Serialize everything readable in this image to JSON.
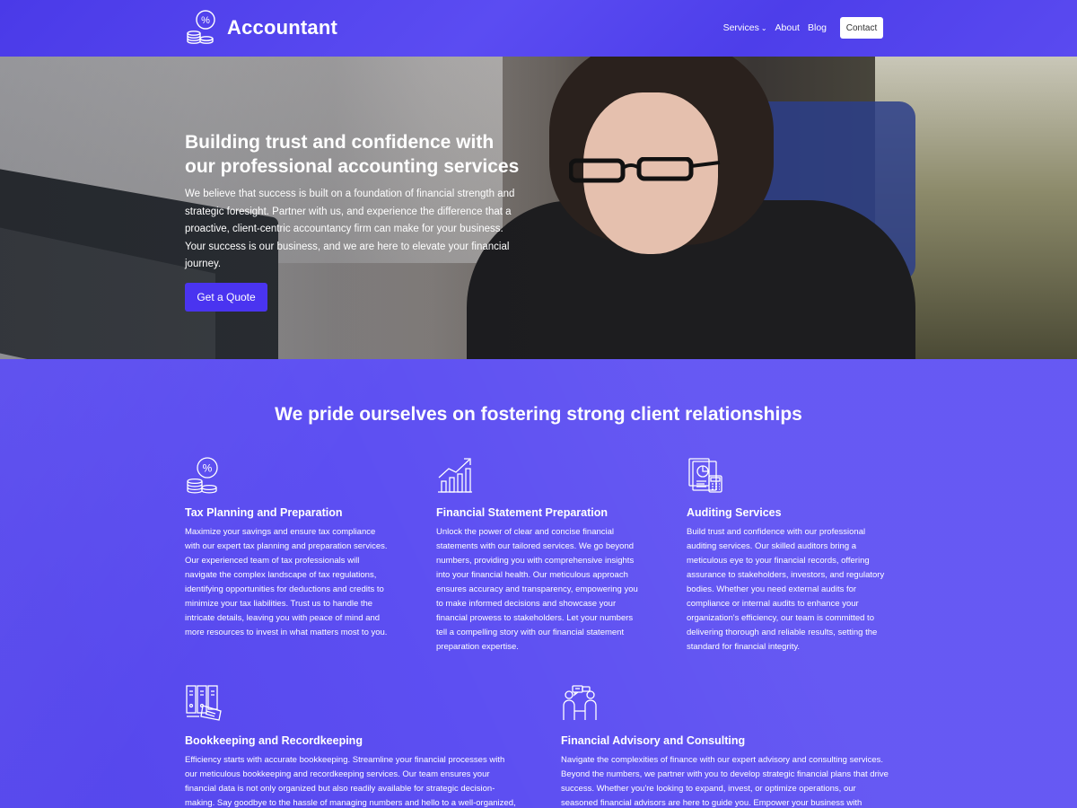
{
  "header": {
    "brand": "Accountant",
    "nav": {
      "services": "Services",
      "about": "About",
      "blog": "Blog",
      "contact": "Contact"
    }
  },
  "hero": {
    "title": "Building trust and confidence with our professional accounting services",
    "text": "We believe that success is built on a foundation of financial strength and strategic foresight. Partner with us, and experience the difference that a proactive, client-centric accountancy firm can make for your business. Your success is our business, and we are here to elevate your financial journey.",
    "cta": "Get a Quote"
  },
  "main": {
    "title": "We pride ourselves on fostering strong client relationships",
    "services": [
      {
        "icon": "coins-percent-icon",
        "title": "Tax Planning and Preparation",
        "desc": "Maximize your savings and ensure tax compliance with our expert tax planning and preparation services. Our experienced team of tax professionals will navigate the complex landscape of tax regulations, identifying opportunities for deductions and credits to minimize your tax liabilities. Trust us to handle the intricate details, leaving you with peace of mind and more resources to invest in what matters most to you."
      },
      {
        "icon": "growth-chart-icon",
        "title": "Financial Statement Preparation",
        "desc": "Unlock the power of clear and concise financial statements with our tailored services. We go beyond numbers, providing you with comprehensive insights into your financial health. Our meticulous approach ensures accuracy and transparency, empowering you to make informed decisions and showcase your financial prowess to stakeholders. Let your numbers tell a compelling story with our financial statement preparation expertise."
      },
      {
        "icon": "audit-report-icon",
        "title": "Auditing Services",
        "desc": "Build trust and confidence with our professional auditing services. Our skilled auditors bring a meticulous eye to your financial records, offering assurance to stakeholders, investors, and regulatory bodies. Whether you need external audits for compliance or internal audits to enhance your organization's efficiency, our team is committed to delivering thorough and reliable results, setting the standard for financial integrity."
      },
      {
        "icon": "binders-icon",
        "title": "Bookkeeping and Recordkeeping",
        "desc": "Efficiency starts with accurate bookkeeping. Streamline your financial processes with our meticulous bookkeeping and recordkeeping services. Our team ensures your financial data is not only organized but also readily available for strategic decision-making. Say goodbye to the hassle of managing numbers and hello to a well-organized,"
      },
      {
        "icon": "consulting-people-icon",
        "title": "Financial Advisory and Consulting",
        "desc": "Navigate the complexities of finance with our expert advisory and consulting services. Beyond the numbers, we partner with you to develop strategic financial plans that drive success. Whether you're looking to expand, invest, or optimize operations, our seasoned financial advisors are here to guide you. Empower your business with insights that"
      }
    ]
  }
}
